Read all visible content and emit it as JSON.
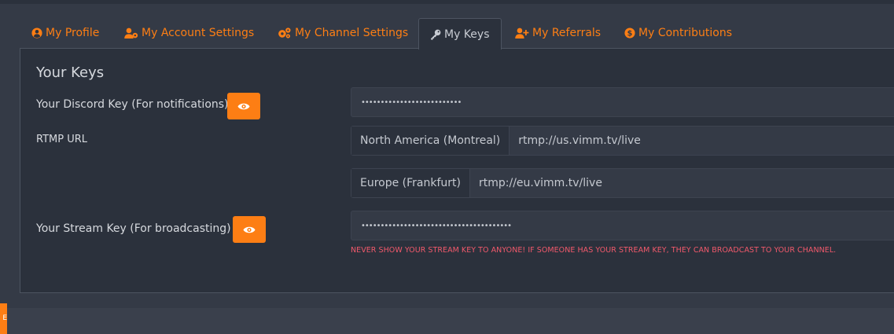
{
  "tabs": [
    {
      "label": "My Profile",
      "icon": "user-circle-icon"
    },
    {
      "label": "My Account Settings",
      "icon": "user-cog-icon"
    },
    {
      "label": "My Channel Settings",
      "icon": "cogs-icon"
    },
    {
      "label": "My Keys",
      "icon": "key-icon",
      "active": true
    },
    {
      "label": "My Referrals",
      "icon": "user-plus-icon"
    },
    {
      "label": "My Contributions",
      "icon": "dollar-coin-icon"
    }
  ],
  "keys": {
    "title": "Your Keys",
    "discord_label": "Your Discord Key (For notifications)",
    "discord_value": "••••••••••••••••••••••••••",
    "rtmp_label": "RTMP URL",
    "rtmp": [
      {
        "region": "North America (Montreal)",
        "url": "rtmp://us.vimm.tv/live"
      },
      {
        "region": "Europe (Frankfurt)",
        "url": "rtmp://eu.vimm.tv/live"
      }
    ],
    "stream_label": "Your Stream Key (For broadcasting)",
    "stream_value": "•••••••••••••••••••••••••••••••••••••••",
    "warning": "NEVER SHOW YOUR STREAM KEY TO ANYONE! IF SOMEONE HAS YOUR STREAM KEY, THEY CAN BROADCAST TO YOUR CHANNEL."
  },
  "colors": {
    "accent": "#fd7e14",
    "warning": "#f1596b",
    "panel": "#2b313c",
    "background": "#343a46"
  },
  "side_tab_label": "E"
}
